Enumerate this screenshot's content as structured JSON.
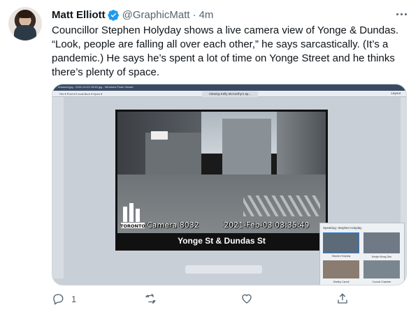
{
  "tweet": {
    "author_name": "Matt Elliott",
    "handle": "@GraphicMatt",
    "separator": "·",
    "time": "4m",
    "text": "Councillor Stephen Holyday shows a live camera view of Yonge & Dundas. “Look, people are falling all over each other,” he says sarcastically. (It’s a pandemic.) He says he’s spent a lot of time on Yonge Street and he thinks there’s plenty of space.",
    "media": {
      "window_title": "unsaved.jpg - 2021-02-03 15:59.jpg - Windows Photo Viewer",
      "toolbar_text": "File ▾   Print ▾   E-mail   Burn ▾   Open ▾",
      "viewing_label": "Viewing Kelly McCarthy's ap...",
      "layout_label": "Layout",
      "camera_label": "Camera 8032",
      "camera_timestamp": "2021-Feb-03 03:35:49",
      "camera_caption": "Yonge St & Dundas St",
      "logo_text": "TORONTO",
      "speaking_label": "Speaking: Stephen Holyday",
      "participants": [
        "Stephen Holyday",
        "Kristyn Wong-Tam",
        "Shelley Carroll",
        "Council Chamber"
      ]
    },
    "actions": {
      "reply_count": "1",
      "retweet_count": "",
      "like_count": "",
      "share_label": ""
    }
  },
  "colors": {
    "verified": "#1d9bf0",
    "secondary_text": "#536471",
    "primary_text": "#0f1419"
  }
}
